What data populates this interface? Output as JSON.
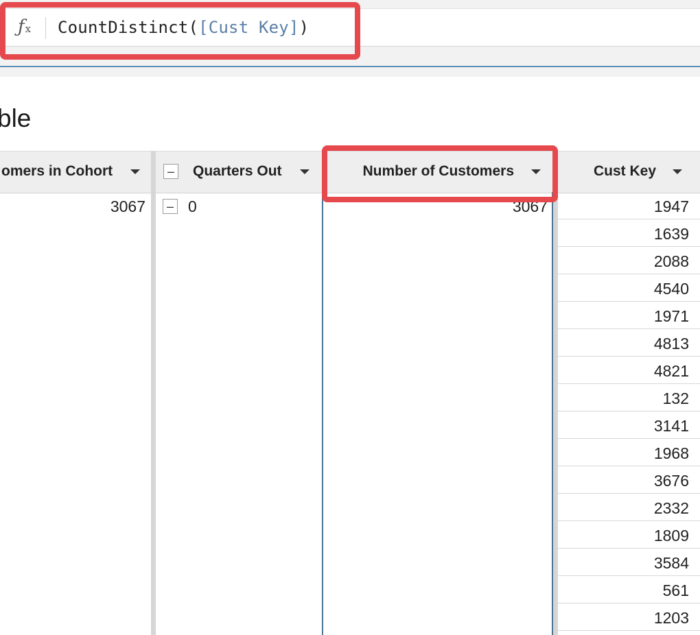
{
  "formula_bar": {
    "fx_symbol": "ƒ",
    "fx_sub": "x",
    "func_open": "CountDistinct(",
    "ref": "[Cust Key]",
    "func_close": ")"
  },
  "title": "ble",
  "columns": {
    "customers_in_cohort": "omers in Cohort",
    "quarters_out": "Quarters Out",
    "number_of_customers": "Number of Customers",
    "cust_key": "Cust Key"
  },
  "group_row": {
    "customers_in_cohort": "3067",
    "quarters_out": "0",
    "number_of_customers": "3067"
  },
  "cust_keys": [
    "1947",
    "1639",
    "2088",
    "4540",
    "1971",
    "4813",
    "4821",
    "132",
    "3141",
    "1968",
    "3676",
    "2332",
    "1809",
    "3584",
    "561",
    "1203"
  ],
  "colors": {
    "highlight": "#e5484d",
    "formula_ref": "#5a7fa8",
    "selected_border": "#4c7694"
  }
}
